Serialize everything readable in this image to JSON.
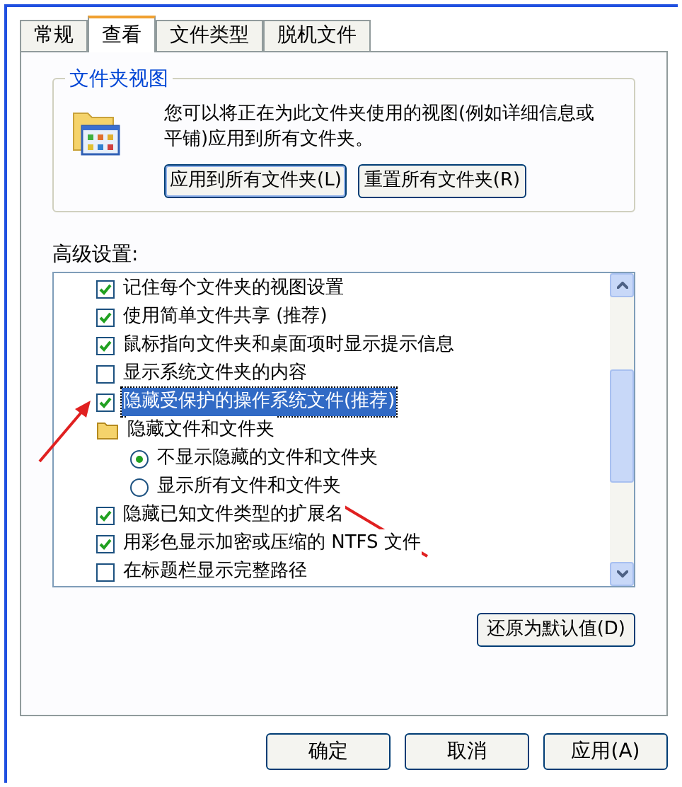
{
  "tabs": [
    {
      "label": "常规",
      "selected": false
    },
    {
      "label": "查看",
      "selected": true
    },
    {
      "label": "文件类型",
      "selected": false
    },
    {
      "label": "脱机文件",
      "selected": false
    }
  ],
  "folder_view": {
    "title": "文件夹视图",
    "description": "您可以将正在为此文件夹使用的视图(例如详细信息或平铺)应用到所有文件夹。",
    "buttons": [
      {
        "label": "应用到所有文件夹(L)",
        "focused": true
      },
      {
        "label": "重置所有文件夹(R)",
        "focused": false
      }
    ]
  },
  "advanced": {
    "label": "高级设置:",
    "items": [
      {
        "kind": "checkbox",
        "label": "记住每个文件夹的视图设置",
        "checked": true,
        "selected": false
      },
      {
        "kind": "checkbox",
        "label": "使用简单文件共享 (推荐)",
        "checked": true,
        "selected": false
      },
      {
        "kind": "checkbox",
        "label": "鼠标指向文件夹和桌面项时显示提示信息",
        "checked": true,
        "selected": false
      },
      {
        "kind": "checkbox",
        "label": "显示系统文件夹的内容",
        "checked": false,
        "selected": false
      },
      {
        "kind": "checkbox",
        "label": "隐藏受保护的操作系统文件(推荐)",
        "checked": true,
        "selected": true
      },
      {
        "kind": "folder",
        "label": "隐藏文件和文件夹",
        "selected": false,
        "children": [
          {
            "kind": "radio",
            "label": "不显示隐藏的文件和文件夹",
            "checked": true,
            "selected": false
          },
          {
            "kind": "radio",
            "label": "显示所有文件和文件夹",
            "checked": false,
            "selected": false
          }
        ]
      },
      {
        "kind": "checkbox",
        "label": "隐藏已知文件类型的扩展名",
        "checked": true,
        "selected": false
      },
      {
        "kind": "checkbox",
        "label": "用彩色显示加密或压缩的 NTFS 文件",
        "checked": true,
        "selected": false
      },
      {
        "kind": "checkbox",
        "label": "在标题栏显示完整路径",
        "checked": false,
        "selected": false
      }
    ]
  },
  "restore_button": "还原为默认值(D)",
  "buttons": [
    "确定",
    "取消",
    "应用(A)"
  ]
}
